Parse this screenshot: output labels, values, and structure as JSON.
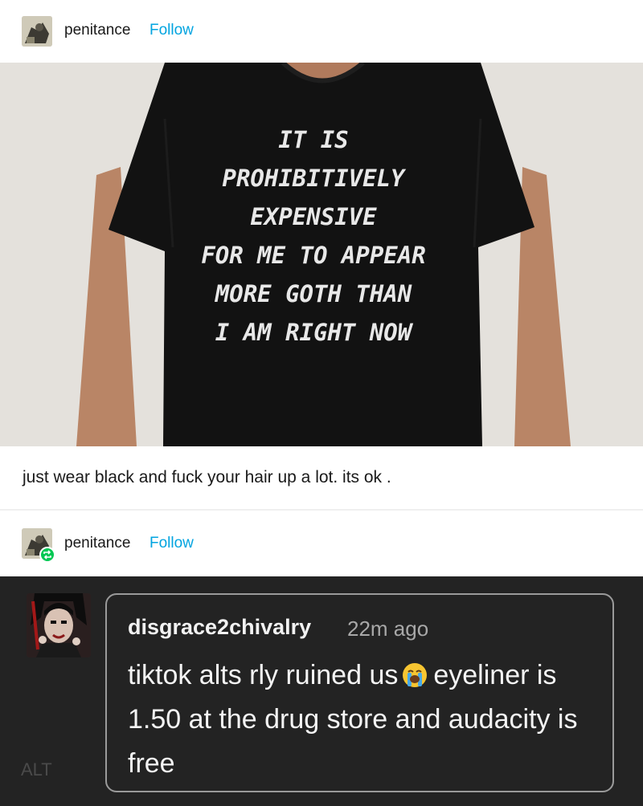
{
  "posts": [
    {
      "header": {
        "username": "penitance",
        "follow_label": "Follow"
      },
      "photo": {
        "shirt_text_lines": [
          "IT IS",
          "PROHIBITIVELY",
          "EXPENSIVE",
          "FOR ME TO APPEAR",
          "MORE GOTH THAN",
          "I AM RIGHT NOW"
        ]
      },
      "caption": "just wear black and fuck your hair up a lot. its ok ."
    },
    {
      "header": {
        "username": "penitance",
        "follow_label": "Follow"
      },
      "tweet": {
        "author": "disgrace2chivalry",
        "time": "22m ago",
        "text_before_emoji": "tiktok alts rly ruined us",
        "emoji": "loudly-crying-face",
        "text_after_emoji": "eyeliner is 1.50 at the drug store and audacity is free",
        "alt_label": "ALT"
      }
    }
  ],
  "colors": {
    "follow": "#00a4e0",
    "dark_background": "#232323",
    "shirt": "#121212",
    "shirt_text": "#e8e8e8",
    "reblog_badge": "#00c853"
  }
}
